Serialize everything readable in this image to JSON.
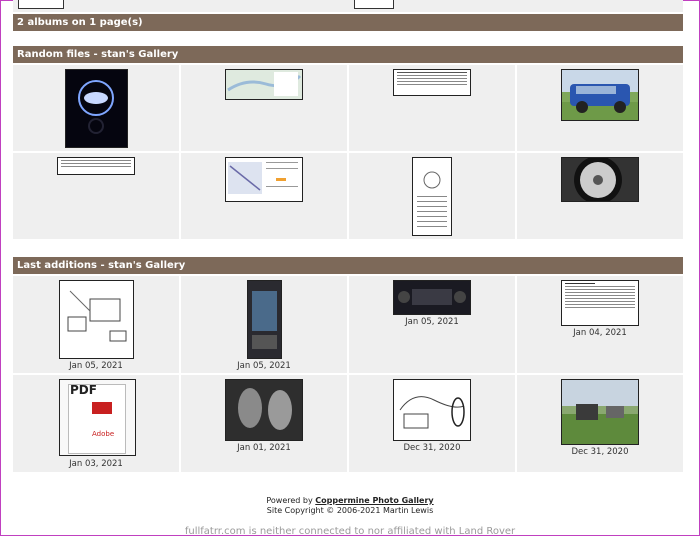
{
  "albums_summary": "2 albums on 1 page(s)",
  "random_section": {
    "title": "Random files - stan's Gallery",
    "items": [
      {
        "thumb": "land-rover-logo"
      },
      {
        "thumb": "map-document"
      },
      {
        "thumb": "table-document"
      },
      {
        "thumb": "blue-range-rover"
      },
      {
        "thumb": "text-document"
      },
      {
        "thumb": "chart-document"
      },
      {
        "thumb": "manual-page"
      },
      {
        "thumb": "alloy-wheel"
      }
    ]
  },
  "last_section": {
    "title": "Last additions - stan's Gallery",
    "items": [
      {
        "thumb": "parts-diagram",
        "date": "Jan 05, 2021"
      },
      {
        "thumb": "touchscreen-unit",
        "date": "Jan 05, 2021"
      },
      {
        "thumb": "climate-panel",
        "date": "Jan 05, 2021"
      },
      {
        "thumb": "spec-sheet",
        "date": "Jan 04, 2021"
      },
      {
        "thumb": "pdf-icon",
        "date": "Jan 03, 2021",
        "pdf_label": "PDF",
        "adobe_label": "Adobe"
      },
      {
        "thumb": "trim-panel-photo",
        "date": "Jan 01, 2021"
      },
      {
        "thumb": "wiring-diagram",
        "date": "Dec 31, 2020"
      },
      {
        "thumb": "cars-on-grass",
        "date": "Dec 31, 2020"
      }
    ]
  },
  "footer": {
    "powered_by": "Powered by",
    "link": "Coppermine Photo Gallery",
    "copyright": "Site Copyright © 2006-2021 Martin Lewis"
  },
  "disclaimer": "fullfatrr.com is neither connected to nor affiliated with Land Rover"
}
